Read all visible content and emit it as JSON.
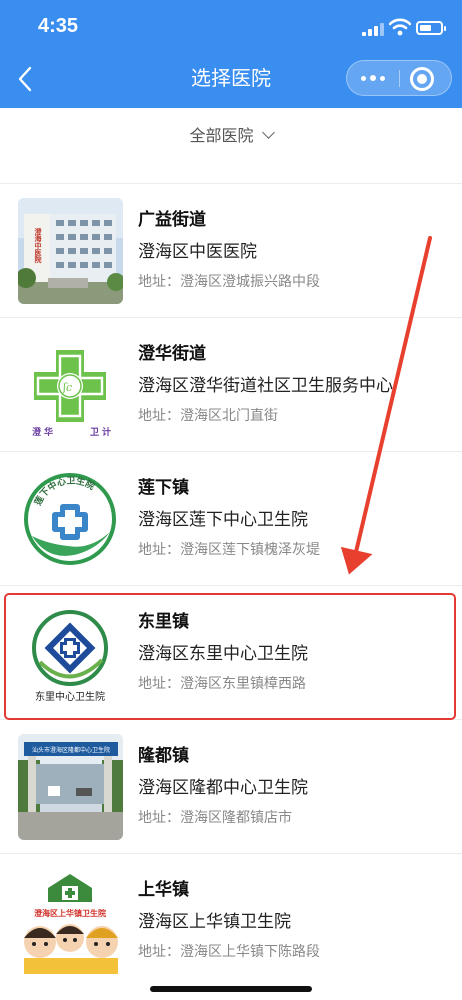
{
  "status_bar": {
    "time": "4:35"
  },
  "nav": {
    "title": "选择医院"
  },
  "filter": {
    "label": "全部医院"
  },
  "colors": {
    "header_bg": "#3a8ef0",
    "highlight": "#e53a34",
    "arrow": "#e8402f"
  },
  "hospitals": [
    {
      "district": "广益街道",
      "name": "澄海区中医医院",
      "address": "地址：澄海区澄城振兴路中段",
      "thumb": "hospital-building-photo",
      "thumb_text": "澄海中医院"
    },
    {
      "district": "澄华街道",
      "name": "澄海区澄华街道社区卫生服务中心",
      "address": "地址：澄海区北门直街",
      "thumb": "green-cross-logo",
      "thumb_text": [
        "澄",
        "华",
        "卫",
        "计"
      ]
    },
    {
      "district": "莲下镇",
      "name": "澄海区莲下中心卫生院",
      "address": "地址：澄海区莲下镇槐泽灰堤",
      "thumb": "circle-cross-logo",
      "thumb_text": "莲下中心卫生院"
    },
    {
      "district": "东里镇",
      "name": "澄海区东里中心卫生院",
      "address": "地址：澄海区东里镇樟西路",
      "thumb": "blue-cross-logo",
      "thumb_text": "东里中心卫生院"
    },
    {
      "district": "隆都镇",
      "name": "澄海区隆都中心卫生院",
      "address": "地址：澄海区隆都镇店市",
      "thumb": "gate-photo",
      "thumb_text": "汕头市澄海区隆都中心卫生院"
    },
    {
      "district": "上华镇",
      "name": "澄海区上华镇卫生院",
      "address": "地址：澄海区上华镇下陈路段",
      "thumb": "cartoon-family-logo",
      "thumb_text": "澄海区上华镇卫生院"
    }
  ]
}
